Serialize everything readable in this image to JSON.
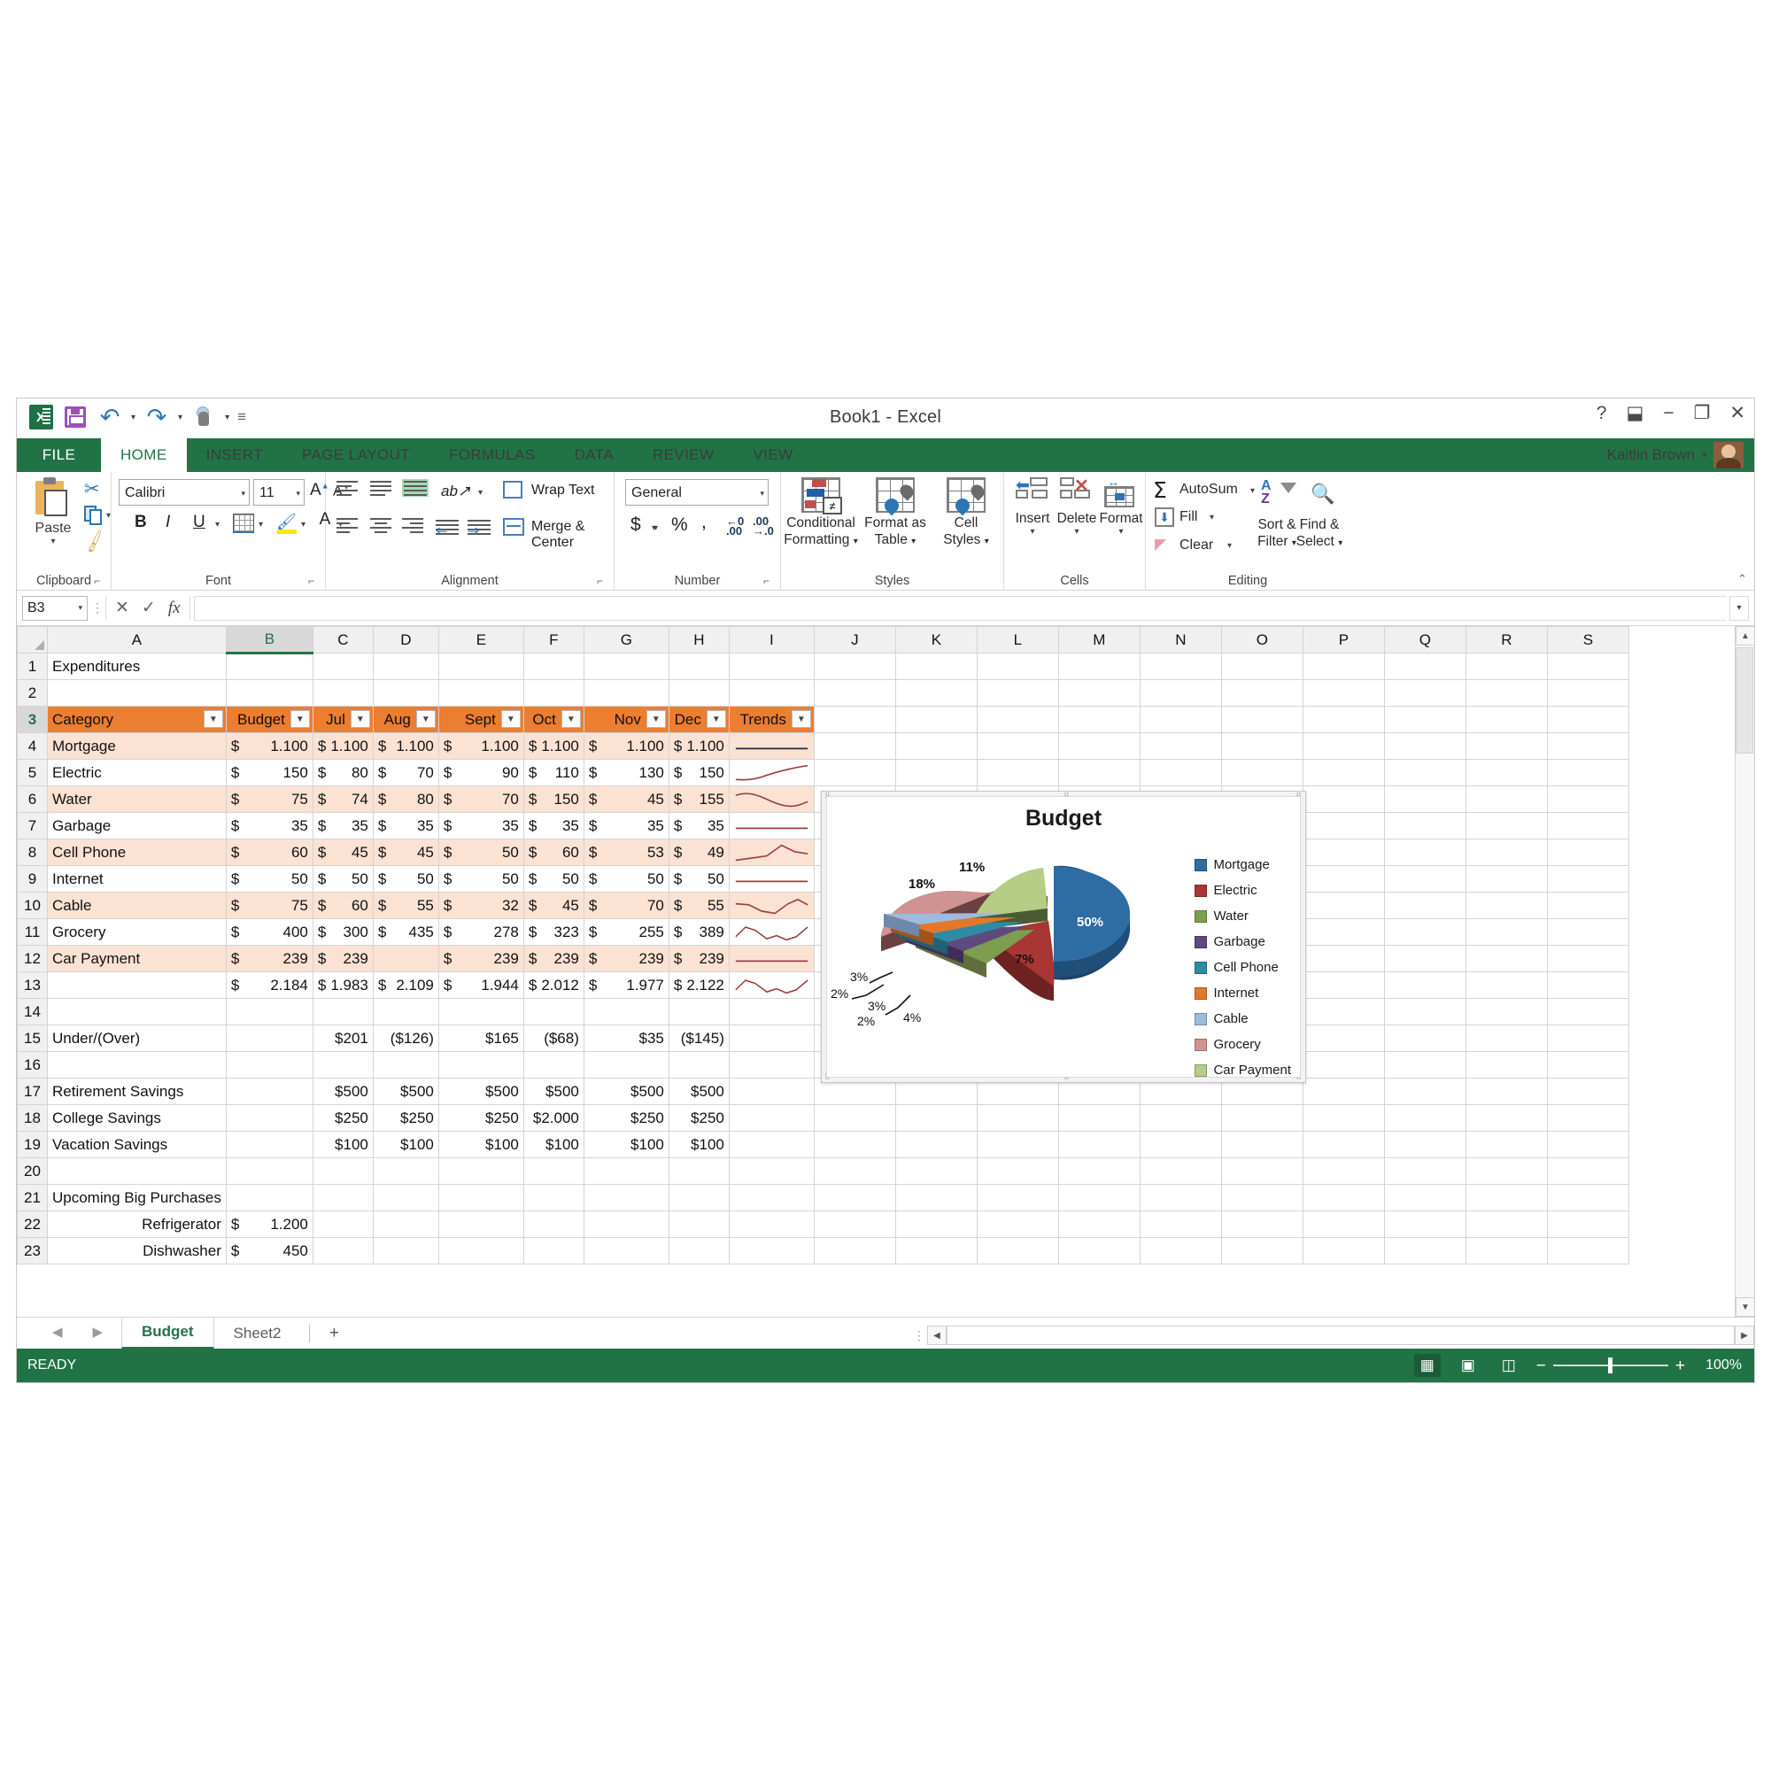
{
  "window": {
    "title": "Book1  -  Excel",
    "user": "Kaitlin Brown",
    "buttons": {
      "help": "?",
      "ribbon_display": "⬓",
      "minimize": "−",
      "restore": "❐",
      "close": "✕"
    }
  },
  "qat": {
    "items": [
      {
        "name": "excel-logo",
        "label": "X"
      },
      {
        "name": "save-icon",
        "label": ""
      },
      {
        "name": "undo-icon",
        "label": "↺"
      },
      {
        "name": "redo-icon",
        "label": "↻"
      },
      {
        "name": "touch-mode-icon",
        "label": ""
      },
      {
        "name": "customize-qat-icon",
        "label": "▾"
      }
    ]
  },
  "ribbon_tabs": [
    {
      "label": "FILE",
      "active": false
    },
    {
      "label": "HOME",
      "active": true
    },
    {
      "label": "INSERT",
      "active": false
    },
    {
      "label": "PAGE LAYOUT",
      "active": false
    },
    {
      "label": "FORMULAS",
      "active": false
    },
    {
      "label": "DATA",
      "active": false
    },
    {
      "label": "REVIEW",
      "active": false
    },
    {
      "label": "VIEW",
      "active": false
    }
  ],
  "ribbon": {
    "clipboard": {
      "group_label": "Clipboard",
      "paste": "Paste",
      "cut": "Cut",
      "copy": "Copy",
      "format_painter": "Format Painter"
    },
    "font": {
      "group_label": "Font",
      "font_name": "Calibri",
      "font_size": "11",
      "bold": "B",
      "italic": "I",
      "underline": "U",
      "grow": "A",
      "shrink": "A"
    },
    "alignment": {
      "group_label": "Alignment",
      "wrap_text": "Wrap Text",
      "merge_center": "Merge & Center",
      "orientation": "ab"
    },
    "number": {
      "group_label": "Number",
      "format": "General",
      "accounting": "$",
      "percent": "%",
      "comma": ",",
      "increase_decimal": ".00",
      "decrease_decimal": ".00"
    },
    "styles": {
      "group_label": "Styles",
      "conditional_formatting": "Conditional\nFormatting",
      "conditional_formatting_l1": "Conditional",
      "conditional_formatting_l2": "Formatting",
      "format_as_table_l1": "Format as",
      "format_as_table_l2": "Table",
      "cell_styles_l1": "Cell",
      "cell_styles_l2": "Styles"
    },
    "cells": {
      "group_label": "Cells",
      "insert": "Insert",
      "delete": "Delete",
      "format": "Format"
    },
    "editing": {
      "group_label": "Editing",
      "autosum": "AutoSum",
      "fill": "Fill",
      "clear": "Clear",
      "sort_filter_l1": "Sort &",
      "sort_filter_l2": "Filter",
      "find_select_l1": "Find &",
      "find_select_l2": "Select"
    }
  },
  "formula_bar": {
    "name_box": "B3",
    "formula": "",
    "cancel": "✕",
    "enter": "✓",
    "insert_function": "fx"
  },
  "sheet": {
    "columns": [
      "A",
      "B",
      "C",
      "D",
      "E",
      "F",
      "G",
      "H",
      "I",
      "J",
      "K",
      "L",
      "M",
      "N",
      "O",
      "P",
      "Q",
      "R",
      "S"
    ],
    "selected_column": "B",
    "selected_row": "3",
    "rows": [
      "1",
      "2",
      "3",
      "4",
      "5",
      "6",
      "7",
      "8",
      "9",
      "10",
      "11",
      "12",
      "13",
      "14",
      "15",
      "16",
      "17",
      "18",
      "19",
      "20",
      "21",
      "22",
      "23"
    ],
    "title_cell": "Expenditures",
    "table_headers": [
      "Category",
      "Budget",
      "Jul",
      "Aug",
      "Sept",
      "Oct",
      "Nov",
      "Dec",
      "Trends"
    ],
    "table_rows": [
      {
        "category": "Mortgage",
        "budget": "1.100",
        "jul": "1.100",
        "aug": "1.100",
        "sept": "1.100",
        "oct": "1.100",
        "nov": "1.100",
        "dec": "1.100",
        "trend": "flat"
      },
      {
        "category": "Electric",
        "budget": "150",
        "jul": "80",
        "aug": "70",
        "sept": "90",
        "oct": "110",
        "nov": "130",
        "dec": "150",
        "trend": "rising"
      },
      {
        "category": "Water",
        "budget": "75",
        "jul": "74",
        "aug": "80",
        "sept": "70",
        "oct": "150",
        "nov": "45",
        "dec": "155",
        "trend": "wavy"
      },
      {
        "category": "Garbage",
        "budget": "35",
        "jul": "35",
        "aug": "35",
        "sept": "35",
        "oct": "35",
        "nov": "35",
        "dec": "35",
        "trend": "flat"
      },
      {
        "category": "Cell Phone",
        "budget": "60",
        "jul": "45",
        "aug": "45",
        "sept": "50",
        "oct": "60",
        "nov": "53",
        "dec": "49",
        "trend": "peak"
      },
      {
        "category": "Internet",
        "budget": "50",
        "jul": "50",
        "aug": "50",
        "sept": "50",
        "oct": "50",
        "nov": "50",
        "dec": "50",
        "trend": "flat"
      },
      {
        "category": "Cable",
        "budget": "75",
        "jul": "60",
        "aug": "55",
        "sept": "32",
        "oct": "45",
        "nov": "70",
        "dec": "55",
        "trend": "zigzag"
      },
      {
        "category": "Grocery",
        "budget": "400",
        "jul": "300",
        "aug": "435",
        "sept": "278",
        "oct": "323",
        "nov": "255",
        "dec": "389",
        "trend": "jagged"
      },
      {
        "category": "Car Payment",
        "budget": "239",
        "jul": "239",
        "aug": "",
        "sept": "239",
        "oct": "239",
        "nov": "239",
        "dec": "239",
        "trend": "flat"
      }
    ],
    "total_row": {
      "category": "",
      "budget": "2.184",
      "jul": "1.983",
      "aug": "2.109",
      "sept": "1.944",
      "oct": "2.012",
      "nov": "1.977",
      "dec": "2.122",
      "trend": "jagged"
    },
    "under_over": {
      "label": "Under/(Over)",
      "jul": "$201",
      "aug": "($126)",
      "sept": "$165",
      "oct": "($68)",
      "nov": "$35",
      "dec": "($145)"
    },
    "savings": [
      {
        "label": "Retirement Savings",
        "jul": "$500",
        "aug": "$500",
        "sept": "$500",
        "oct": "$500",
        "nov": "$500",
        "dec": "$500"
      },
      {
        "label": "College Savings",
        "jul": "$250",
        "aug": "$250",
        "sept": "$250",
        "oct": "$2.000",
        "nov": "$250",
        "dec": "$250"
      },
      {
        "label": "Vacation Savings",
        "jul": "$100",
        "aug": "$100",
        "sept": "$100",
        "oct": "$100",
        "nov": "$100",
        "dec": "$100"
      }
    ],
    "purchases_title": "Upcoming Big Purchases",
    "purchases": [
      {
        "label": "Refrigerator",
        "amount": "1.200"
      },
      {
        "label": "Dishwasher",
        "amount": "450"
      }
    ],
    "currency_symbol": "$"
  },
  "sheet_tabs": [
    {
      "label": "Budget",
      "active": true
    },
    {
      "label": "Sheet2",
      "active": false
    }
  ],
  "new_sheet": "+",
  "status_bar": {
    "state": "READY",
    "zoom": "100%",
    "views": [
      "normal-view",
      "page-layout-view",
      "page-break-view"
    ]
  },
  "chart_data": {
    "type": "pie",
    "title": "Budget",
    "three_d": true,
    "exploded": true,
    "legend_position": "right",
    "categories": [
      "Mortgage",
      "Electric",
      "Water",
      "Garbage",
      "Cell Phone",
      "Internet",
      "Cable",
      "Grocery",
      "Car Payment"
    ],
    "values": [
      1100,
      150,
      75,
      35,
      60,
      50,
      75,
      400,
      239
    ],
    "labels": [
      "50%",
      "7%",
      "3%",
      "2%",
      "3%",
      "2%",
      "4%",
      "18%",
      "11%"
    ],
    "percentages": [
      50,
      7,
      3,
      2,
      3,
      2,
      4,
      18,
      11
    ],
    "colors": [
      "#2e6ca4",
      "#a83634",
      "#7d9e4e",
      "#5f4a7e",
      "#2d8ba3",
      "#e2792a",
      "#9dbbdd",
      "#cf9391",
      "#b5cd86"
    ]
  }
}
